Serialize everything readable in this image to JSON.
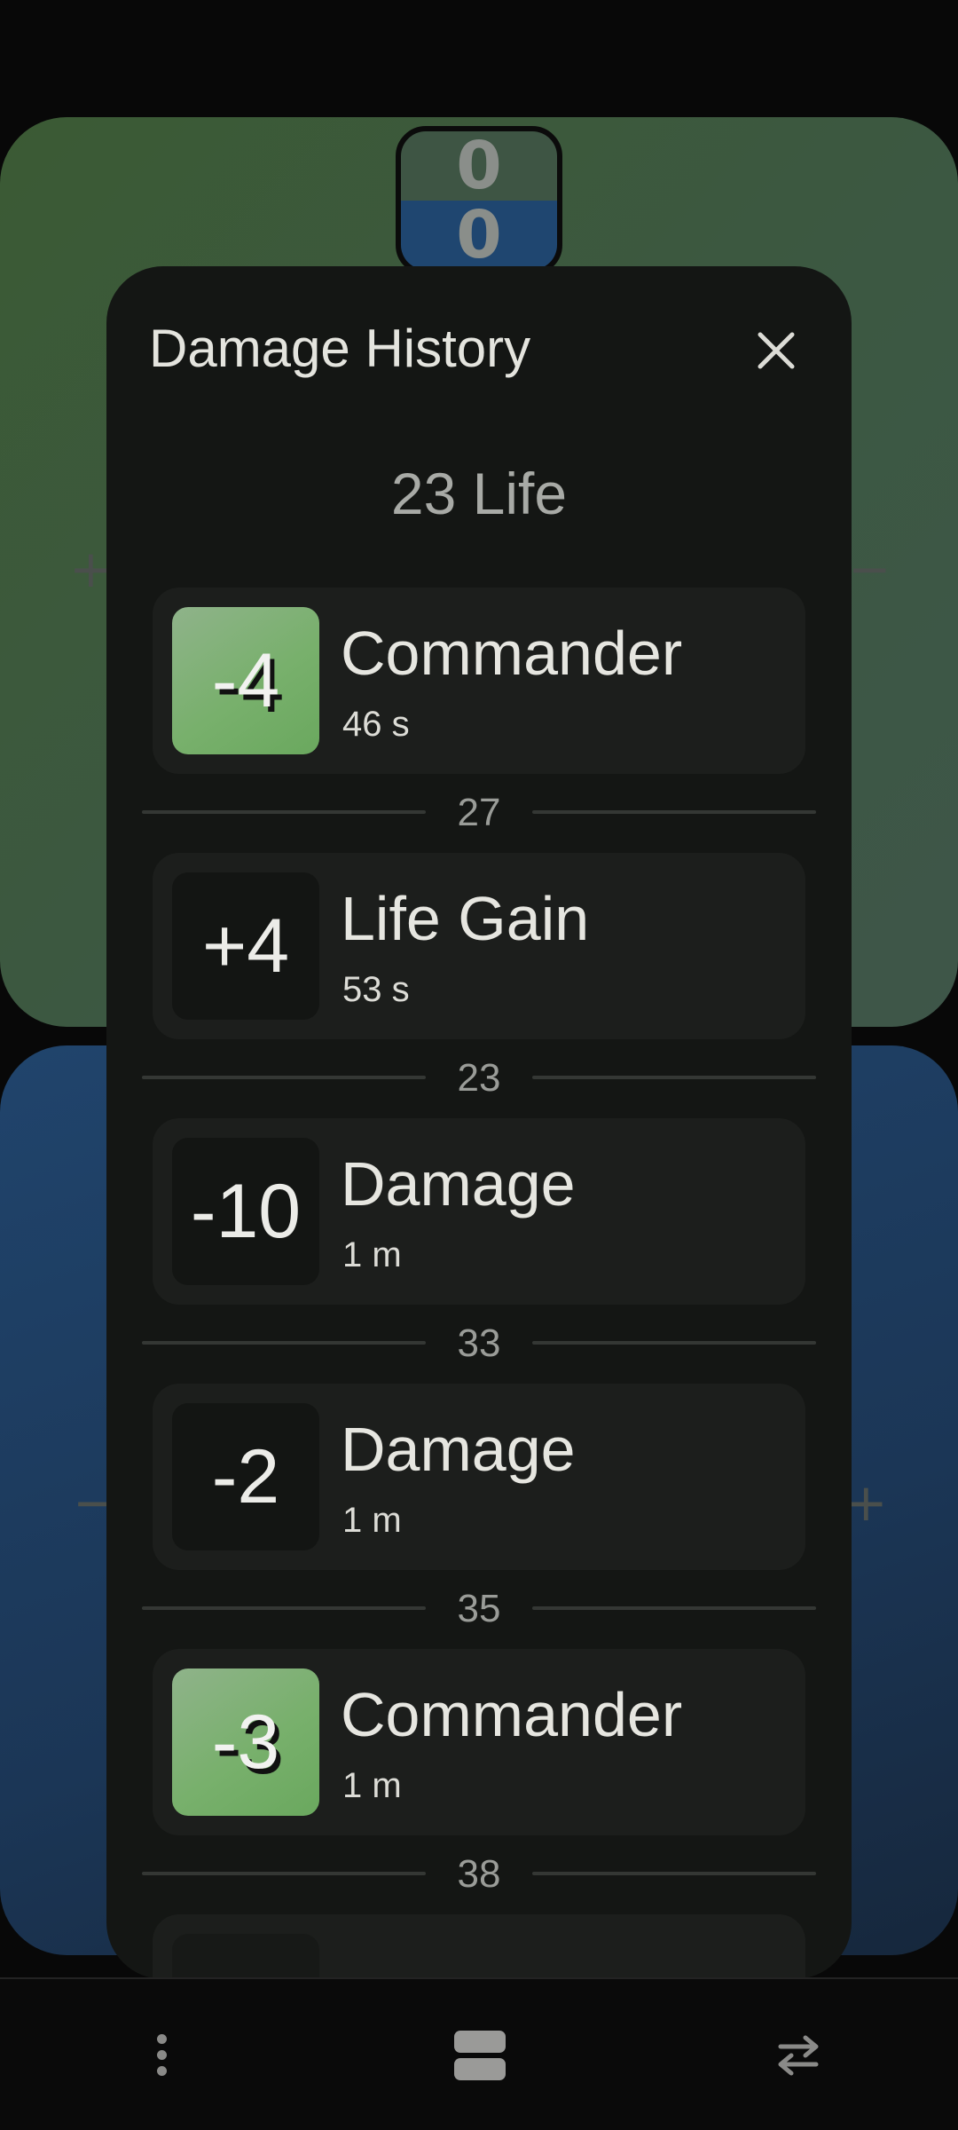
{
  "counter": {
    "top_value": "0",
    "bottom_value": "0"
  },
  "panels": {
    "top_plus": "+",
    "top_minus": "−",
    "bottom_minus": "−",
    "bottom_plus": "+"
  },
  "dialog": {
    "title": "Damage History",
    "close_icon": "close-icon",
    "life_total": "23 Life",
    "entries": [
      {
        "change": "-4",
        "type": "Commander",
        "time": "46 s",
        "style": "green"
      },
      {
        "change": "+4",
        "type": "Life Gain",
        "time": "53 s",
        "style": "dark"
      },
      {
        "change": "-10",
        "type": "Damage",
        "time": "1 m",
        "style": "dark"
      },
      {
        "change": "-2",
        "type": "Damage",
        "time": "1 m",
        "style": "dark"
      },
      {
        "change": "-3",
        "type": "Commander",
        "time": "1 m",
        "style": "green"
      }
    ],
    "dividers": [
      "27",
      "23",
      "33",
      "35",
      "38"
    ]
  },
  "bottom_bar": {
    "icons": [
      "more-vert-icon",
      "layout-icon",
      "swap-icon"
    ]
  },
  "colors": {
    "top_panel": "#3c5842",
    "bottom_panel": "#1b3656",
    "commander_badge": "#78b06c",
    "dialog_bg": "#141614"
  }
}
